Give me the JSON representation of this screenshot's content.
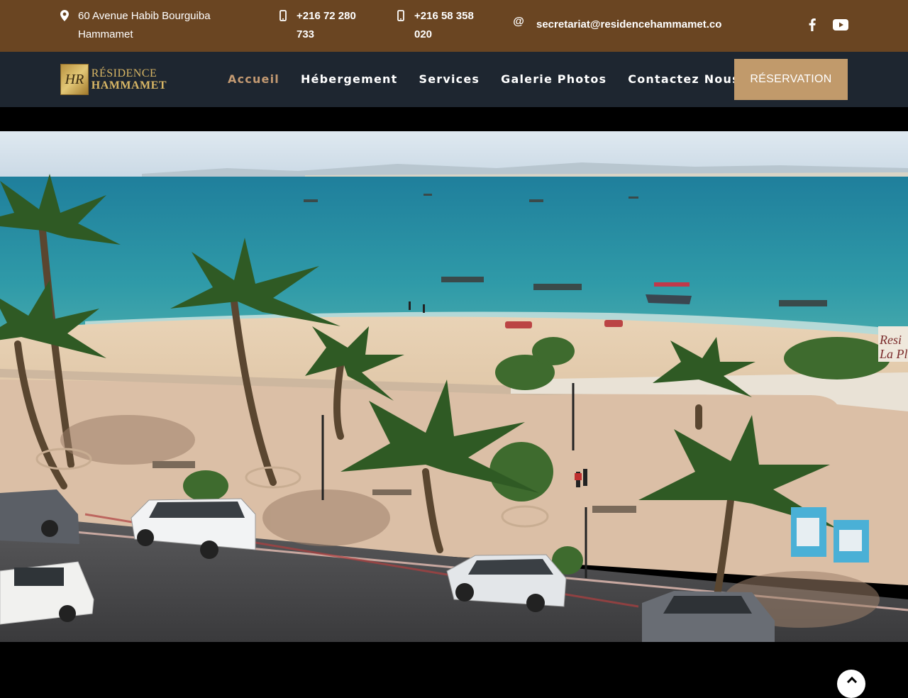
{
  "topbar": {
    "address_line1": "60 Avenue Habib Bourguiba",
    "address_line2": "Hammamet",
    "phone1_line1": "+216 72 280",
    "phone1_line2": "733",
    "phone2_line1": "+216 58 358",
    "phone2_line2": "020",
    "email": "secretariat@residencehammamet.co",
    "icons": {
      "address": "map-marker-icon",
      "phone": "mobile-phone-icon",
      "email": "at-sign-icon"
    },
    "social": [
      "facebook-icon",
      "youtube-icon"
    ],
    "bg_color": "#6a4522"
  },
  "nav": {
    "logo_mark": "HR",
    "logo_line1": "RÉSIDENCE",
    "logo_line2": "HAMMAMET",
    "items": [
      {
        "label": "Accueil",
        "active": true
      },
      {
        "label": "Hébergement",
        "active": false
      },
      {
        "label": "Services",
        "active": false
      },
      {
        "label": "Galerie Photos",
        "active": false
      },
      {
        "label": "Contactez Nous",
        "active": false
      }
    ],
    "cta": "RÉSERVATION",
    "bg_color": "#1e2630",
    "accent": "#c19a6b"
  },
  "hero": {
    "image": "beach-promenade-photo",
    "sign_text": "Resi La Pl"
  }
}
